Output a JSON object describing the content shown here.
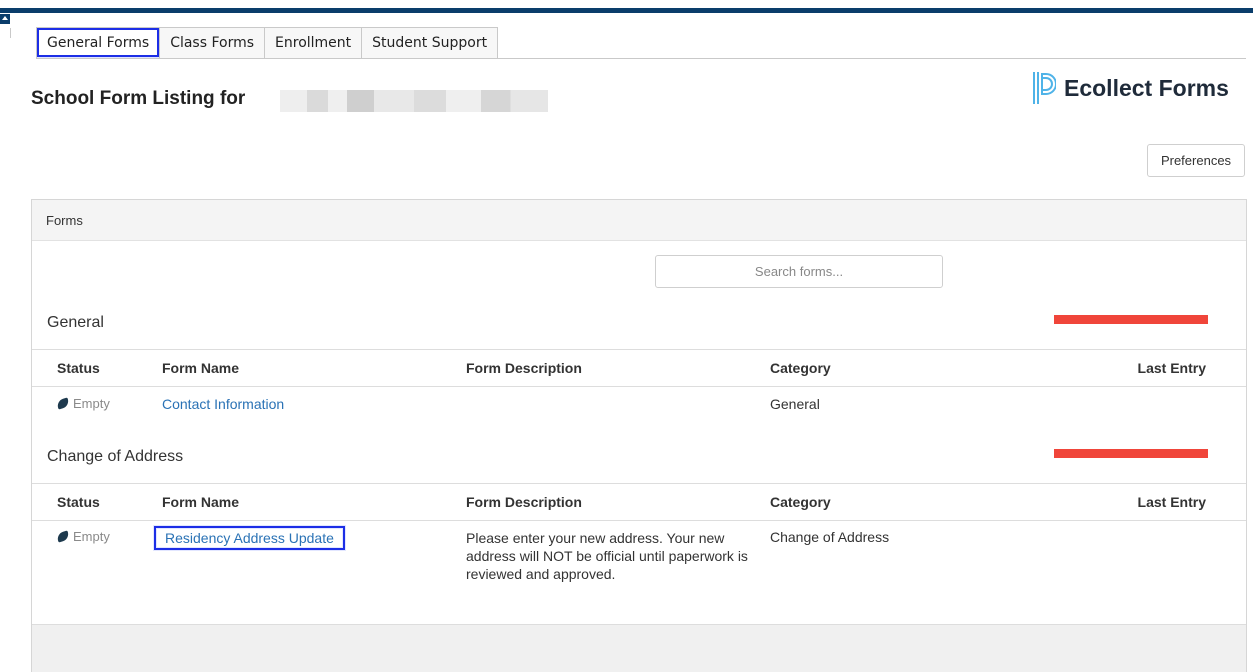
{
  "tabs": [
    {
      "label": "General Forms"
    },
    {
      "label": "Class Forms"
    },
    {
      "label": "Enrollment"
    },
    {
      "label": "Student Support"
    }
  ],
  "page": {
    "title": "School Form Listing for"
  },
  "brand": {
    "name": "Ecollect Forms",
    "icon": "ecollect-logo-icon"
  },
  "preferences": {
    "label": "Preferences"
  },
  "panel": {
    "title": "Forms",
    "search_placeholder": "Search forms...",
    "columns": [
      "Status",
      "Form Name",
      "Form Description",
      "Category",
      "Last Entry"
    ],
    "sections": [
      {
        "title": "General",
        "rows": [
          {
            "status": "Empty",
            "name": "Contact Information",
            "description": "",
            "category": "General",
            "last_entry": ""
          }
        ]
      },
      {
        "title": "Change of Address",
        "rows": [
          {
            "status": "Empty",
            "name": "Residency Address Update",
            "description": "Please enter your new address. Your new address will NOT be official until paperwork is reviewed and approved.",
            "category": "Change of Address",
            "last_entry": ""
          }
        ]
      }
    ]
  },
  "colors": {
    "accent": "#0a3d6b",
    "link": "#2a72b5",
    "highlight": "#1c2ee6",
    "redaction": "#f0453a"
  }
}
